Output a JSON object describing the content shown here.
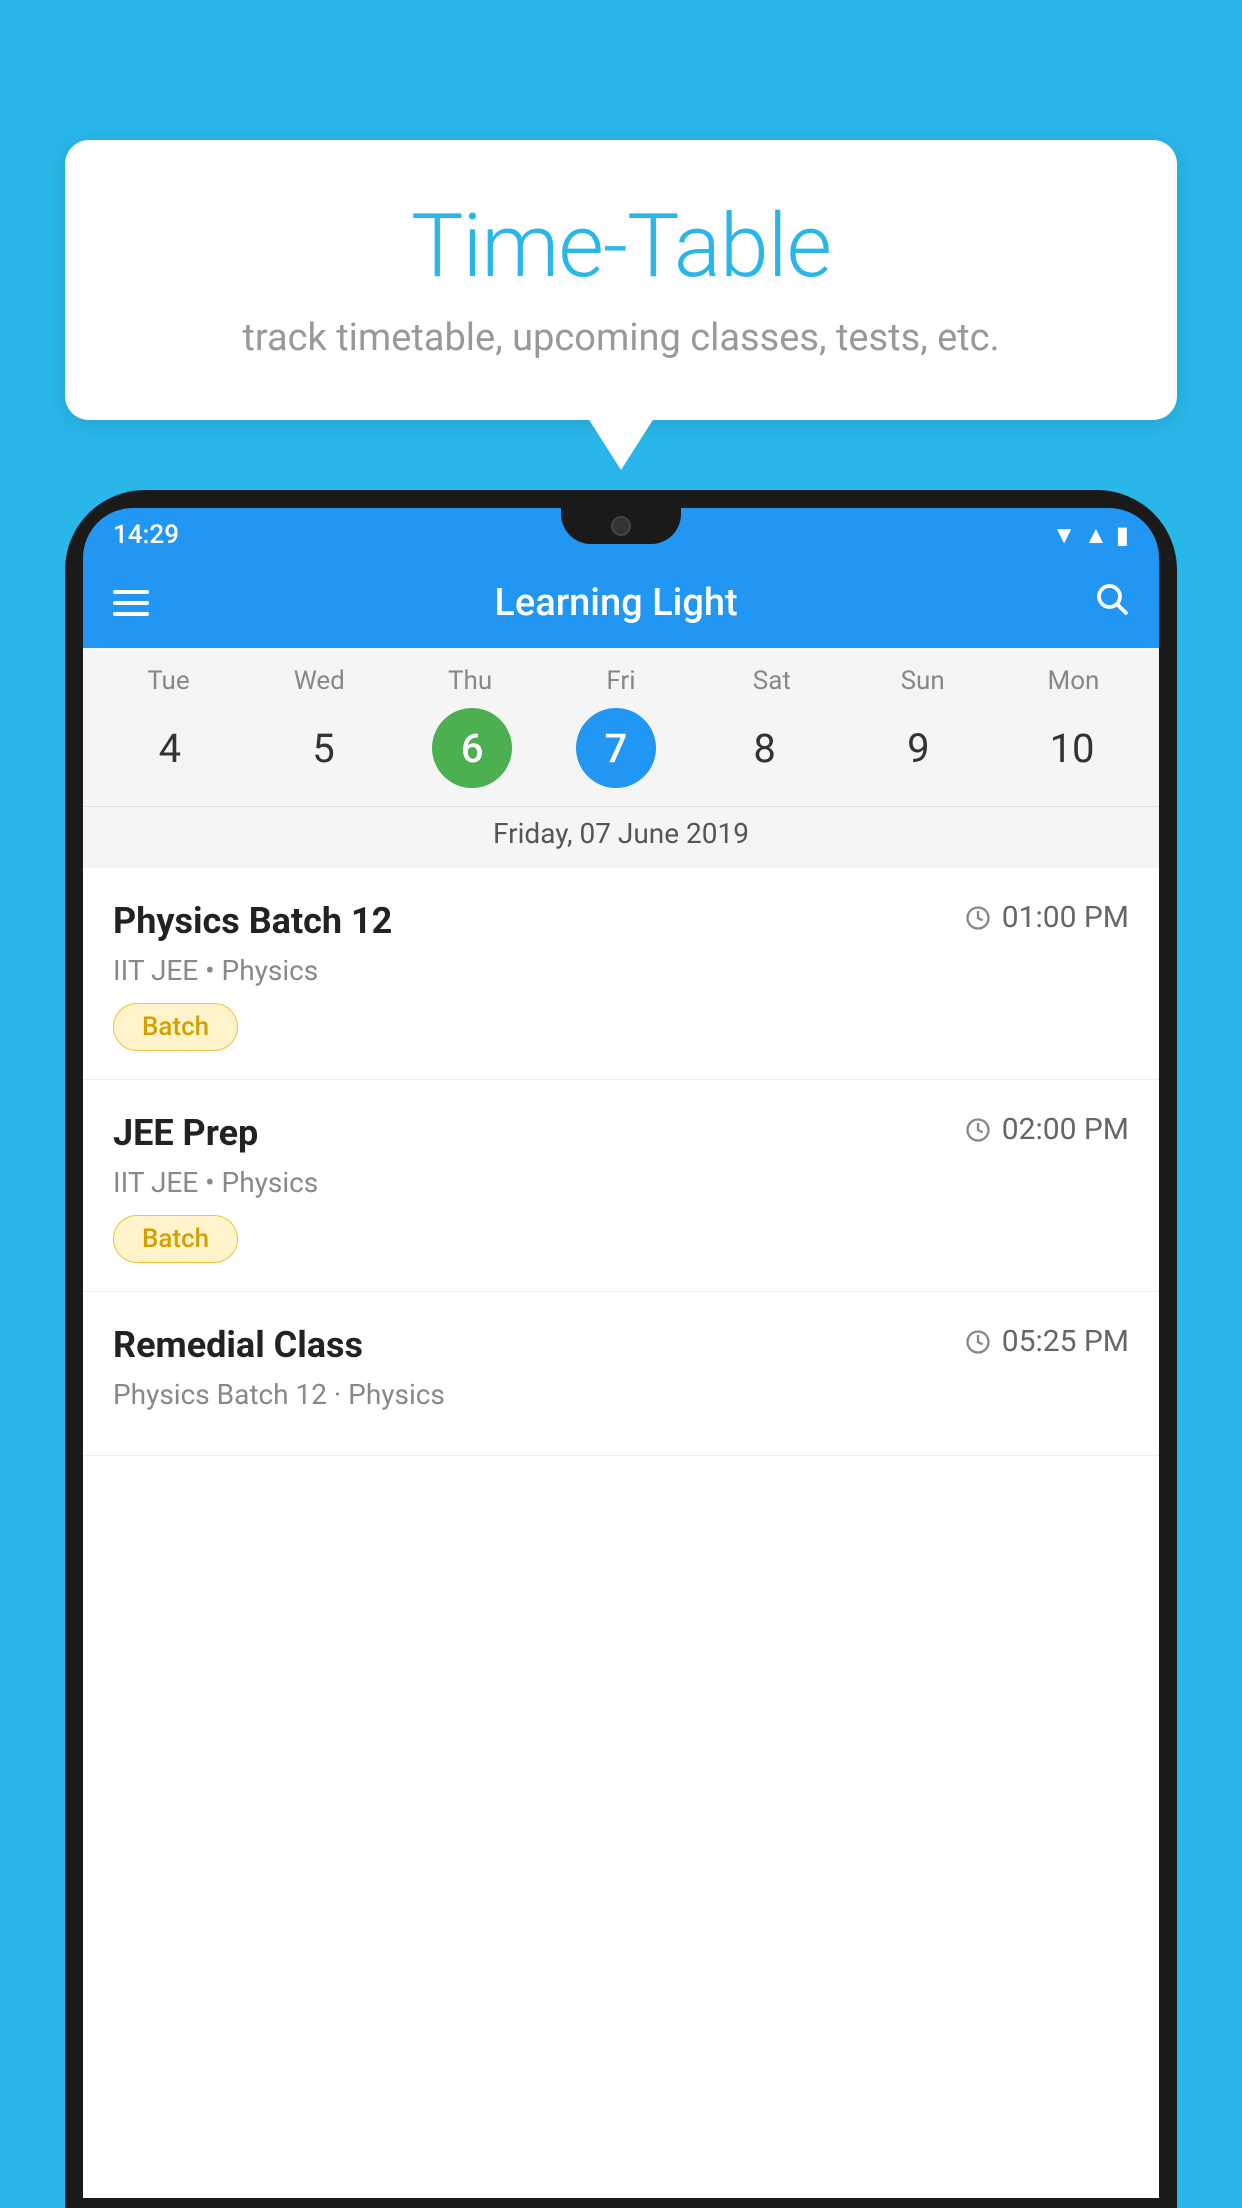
{
  "background_color": "#29B6E8",
  "bubble": {
    "title": "Time-Table",
    "subtitle": "track timetable, upcoming classes, tests, etc."
  },
  "phone": {
    "time": "14:29",
    "app_name": "Learning Light",
    "calendar": {
      "days": [
        {
          "label": "Tue",
          "number": "4"
        },
        {
          "label": "Wed",
          "number": "5"
        },
        {
          "label": "Thu",
          "number": "6",
          "state": "today"
        },
        {
          "label": "Fri",
          "number": "7",
          "state": "selected"
        },
        {
          "label": "Sat",
          "number": "8"
        },
        {
          "label": "Sun",
          "number": "9"
        },
        {
          "label": "Mon",
          "number": "10"
        }
      ],
      "selected_date_label": "Friday, 07 June 2019"
    },
    "classes": [
      {
        "name": "Physics Batch 12",
        "time": "01:00 PM",
        "meta": "IIT JEE • Physics",
        "badge": "Batch"
      },
      {
        "name": "JEE Prep",
        "time": "02:00 PM",
        "meta": "IIT JEE • Physics",
        "badge": "Batch"
      },
      {
        "name": "Remedial Class",
        "time": "05:25 PM",
        "meta": "Physics Batch 12 · Physics",
        "badge": null
      }
    ]
  },
  "icons": {
    "hamburger": "≡",
    "search": "🔍",
    "clock": "⏱"
  }
}
